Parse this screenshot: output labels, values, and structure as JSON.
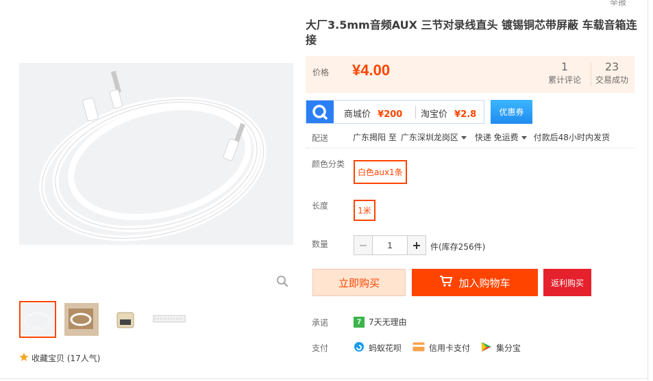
{
  "header": {
    "report_link": "举报"
  },
  "product": {
    "title": "大厂3.5mm音频AUX 三节对录线直头 镀锡铜芯带屏蔽 车载音箱连接",
    "favorite": "收藏宝贝 (17人气)"
  },
  "price": {
    "label": "价格",
    "value": "¥4.00",
    "reviews_count": "1",
    "reviews_label": "累计评论",
    "deals_count": "23",
    "deals_label": "交易成功"
  },
  "compare": {
    "mall_label": "商城价",
    "mall_price": "¥200",
    "taobao_label": "淘宝价",
    "taobao_price": "¥2.8",
    "coupon_button": "优惠券"
  },
  "shipping": {
    "label": "配送",
    "origin": "广东揭阳 至",
    "destination": "广东深圳龙岗区",
    "method": "快递 免运费",
    "dispatch": "付款后48小时内发货"
  },
  "options": {
    "color_label": "颜色分类",
    "color_value": "白色aux1条",
    "length_label": "长度",
    "length_value": "1米"
  },
  "quantity": {
    "label": "数量",
    "minus": "−",
    "value": "1",
    "plus": "+",
    "stock": "件(库存256件)"
  },
  "actions": {
    "buy_now": "立即购买",
    "add_to_cart": "加入购物车",
    "rebate_buy": "返利购买"
  },
  "service": {
    "promise_label": "承诺",
    "promise_icon_text": "7",
    "promise_text": "7天无理由",
    "pay_label": "支付",
    "pay_methods": [
      "蚂蚁花呗",
      "信用卡支付",
      "集分宝"
    ]
  },
  "colors": {
    "accent": "#ff4400",
    "price_bg": "#fff2e8",
    "coupon_blue": "#1f8cf0"
  }
}
